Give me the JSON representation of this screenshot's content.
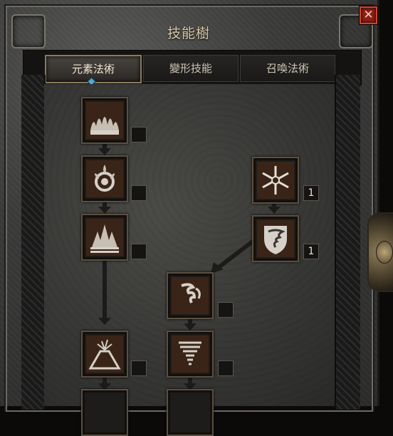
{
  "window": {
    "title": "技能樹",
    "close_icon": "✕"
  },
  "tabs": [
    {
      "label": "元素法術",
      "active": true
    },
    {
      "label": "變形技能",
      "active": false
    },
    {
      "label": "召喚法術",
      "active": false
    }
  ],
  "skills": [
    {
      "name": "flame-wall-icon",
      "points": ""
    },
    {
      "name": "fire-ring-icon",
      "points": ""
    },
    {
      "name": "fire-spike-icon",
      "points": ""
    },
    {
      "name": "frost-snowflake-icon",
      "points": "1"
    },
    {
      "name": "tornado-shield-icon",
      "points": "1"
    },
    {
      "name": "whirlwind-icon",
      "points": ""
    },
    {
      "name": "volcano-icon",
      "points": ""
    },
    {
      "name": "tornado-icon",
      "points": ""
    }
  ],
  "colors": {
    "title_text": "#d8c8a6",
    "close_button": "#8c1f16",
    "active_tab_border": "#8a7a5c",
    "selection_marker": "#4fa8d6"
  }
}
